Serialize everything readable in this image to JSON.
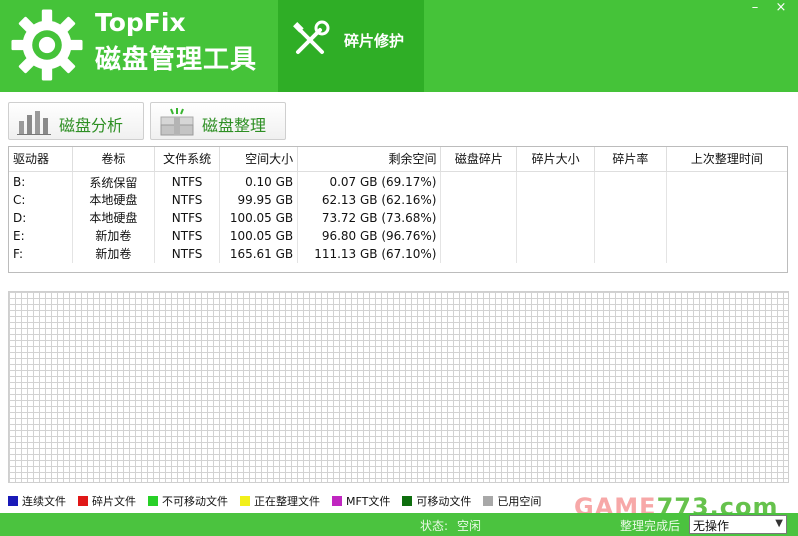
{
  "app": {
    "title": "TopFix",
    "subtitle": "磁盘管理工具"
  },
  "nav": {
    "repair_tab": "碎片修护"
  },
  "window": {
    "minimize": "–",
    "close": "×"
  },
  "toolbar": {
    "analyze_label": "磁盘分析",
    "defrag_label": "磁盘整理"
  },
  "table": {
    "headers": [
      "驱动器",
      "卷标",
      "文件系统",
      "空间大小",
      "剩余空间",
      "磁盘碎片",
      "碎片大小",
      "碎片率",
      "上次整理时间"
    ],
    "rows": [
      {
        "drive": "B:",
        "label": "系统保留",
        "fs": "NTFS",
        "size": "0.10 GB",
        "free": "0.07 GB (69.17%)",
        "frag": "",
        "frag_size": "",
        "frag_rate": "",
        "last": ""
      },
      {
        "drive": "C:",
        "label": "本地硬盘",
        "fs": "NTFS",
        "size": "99.95 GB",
        "free": "62.13 GB (62.16%)",
        "frag": "",
        "frag_size": "",
        "frag_rate": "",
        "last": ""
      },
      {
        "drive": "D:",
        "label": "本地硬盘",
        "fs": "NTFS",
        "size": "100.05 GB",
        "free": "73.72 GB (73.68%)",
        "frag": "",
        "frag_size": "",
        "frag_rate": "",
        "last": ""
      },
      {
        "drive": "E:",
        "label": "新加卷",
        "fs": "NTFS",
        "size": "100.05 GB",
        "free": "96.80 GB (96.76%)",
        "frag": "",
        "frag_size": "",
        "frag_rate": "",
        "last": ""
      },
      {
        "drive": "F:",
        "label": "新加卷",
        "fs": "NTFS",
        "size": "165.61 GB",
        "free": "111.13 GB (67.10%)",
        "frag": "",
        "frag_size": "",
        "frag_rate": "",
        "last": ""
      }
    ]
  },
  "legend": [
    {
      "label": "连续文件",
      "color": "#1a1ab8"
    },
    {
      "label": "碎片文件",
      "color": "#e01818"
    },
    {
      "label": "不可移动文件",
      "color": "#28d028"
    },
    {
      "label": "正在整理文件",
      "color": "#f2f01a"
    },
    {
      "label": "MFT文件",
      "color": "#c026c0"
    },
    {
      "label": "可移动文件",
      "color": "#0e6e0e"
    },
    {
      "label": "已用空间",
      "color": "#a8a8a8"
    }
  ],
  "watermark": {
    "left": "GAME",
    "right": "773.com"
  },
  "status": {
    "label": "状态:",
    "value": "空闲",
    "after_label": "整理完成后",
    "after_value": "无操作"
  },
  "colors": {
    "header_green": "#45c339",
    "tab_green": "#2fae26",
    "status_green": "#4bc33f"
  }
}
